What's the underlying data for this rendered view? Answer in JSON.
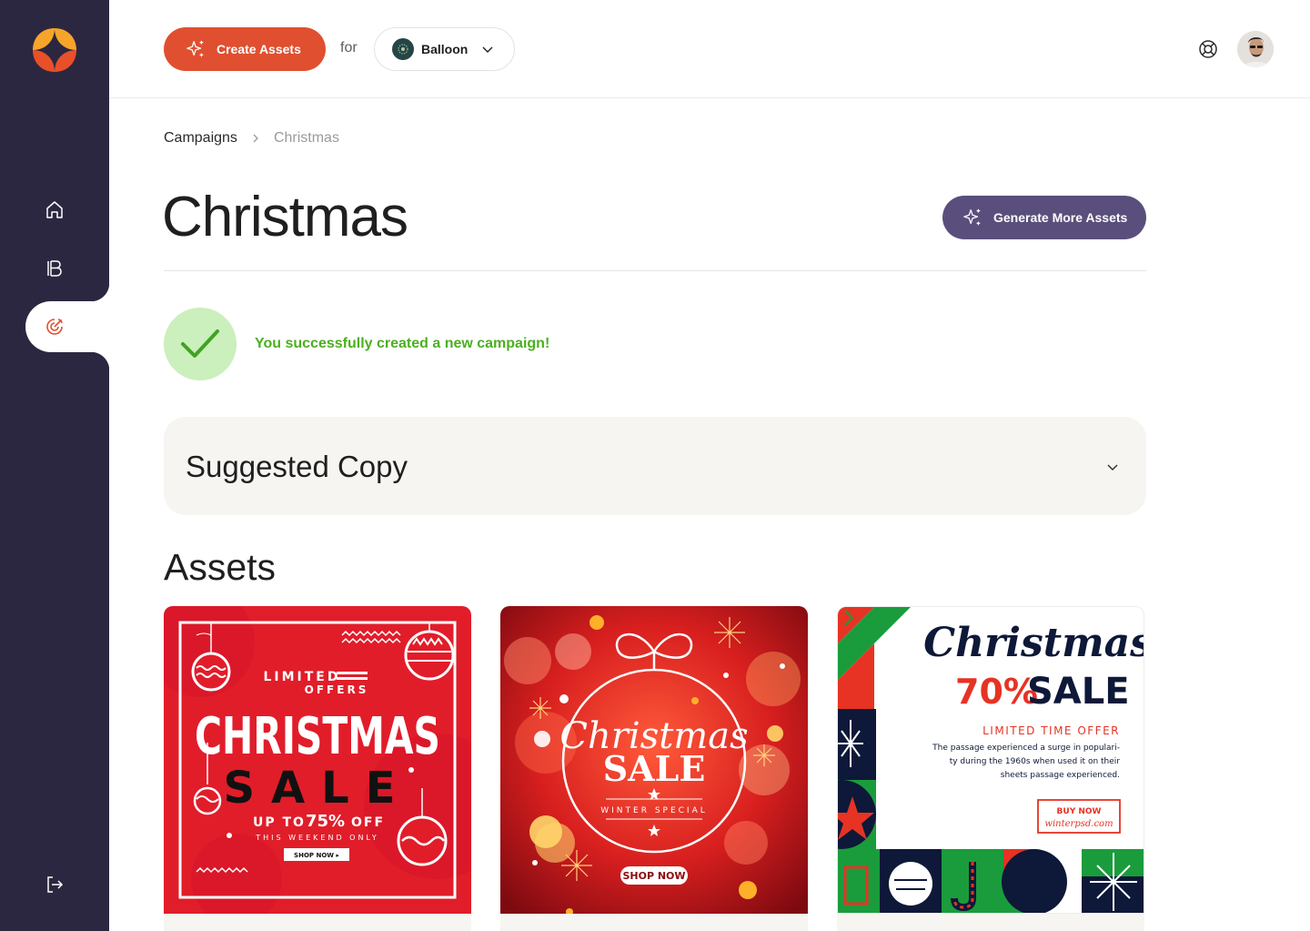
{
  "sidebar": {
    "logo_icon": "sparkle-logo",
    "items": [
      {
        "name": "home",
        "icon": "home-icon"
      },
      {
        "name": "brands",
        "icon": "brand-b-icon"
      },
      {
        "name": "campaigns",
        "icon": "target-icon",
        "active": true
      }
    ],
    "logout_icon": "logout-icon"
  },
  "topbar": {
    "create_label": "Create Assets",
    "for_label": "for",
    "brand_name": "Balloon",
    "help_icon": "lifebuoy-icon"
  },
  "breadcrumb": {
    "parent": "Campaigns",
    "current": "Christmas"
  },
  "page": {
    "title": "Christmas",
    "generate_label": "Generate More Assets"
  },
  "success": {
    "message": "You successfully created a new campaign!"
  },
  "suggested_copy": {
    "title": "Suggested Copy"
  },
  "assets": {
    "heading": "Assets",
    "items": [
      {
        "top": "LIMITED",
        "top2": "OFFERS",
        "main": "CHRISTMAS",
        "sub": "SALE",
        "offer_prefix": "UP TO",
        "offer_value": "75%",
        "offer_suffix": "OFF",
        "tagline": "THIS WEEKEND ONLY",
        "cta": "SHOP NOW ▸"
      },
      {
        "script": "Christmas",
        "main": "SALE",
        "sub": "WINTER SPECIAL",
        "cta": "SHOP NOW"
      },
      {
        "script": "Christmas",
        "percent": "70%",
        "main": "SALE",
        "sub": "LIMITED TIME OFFER",
        "body1": "The passage experienced a surge in populari-",
        "body2": "ty during the 1960s when used it on their",
        "body3": "sheets passage experienced.",
        "cta": "BUY NOW",
        "url": "winterpsd.com"
      }
    ]
  },
  "colors": {
    "sidebar": "#2c2740",
    "accent": "#e04f2f",
    "secondary": "#5a4f7c",
    "success": "#4caf1f"
  }
}
